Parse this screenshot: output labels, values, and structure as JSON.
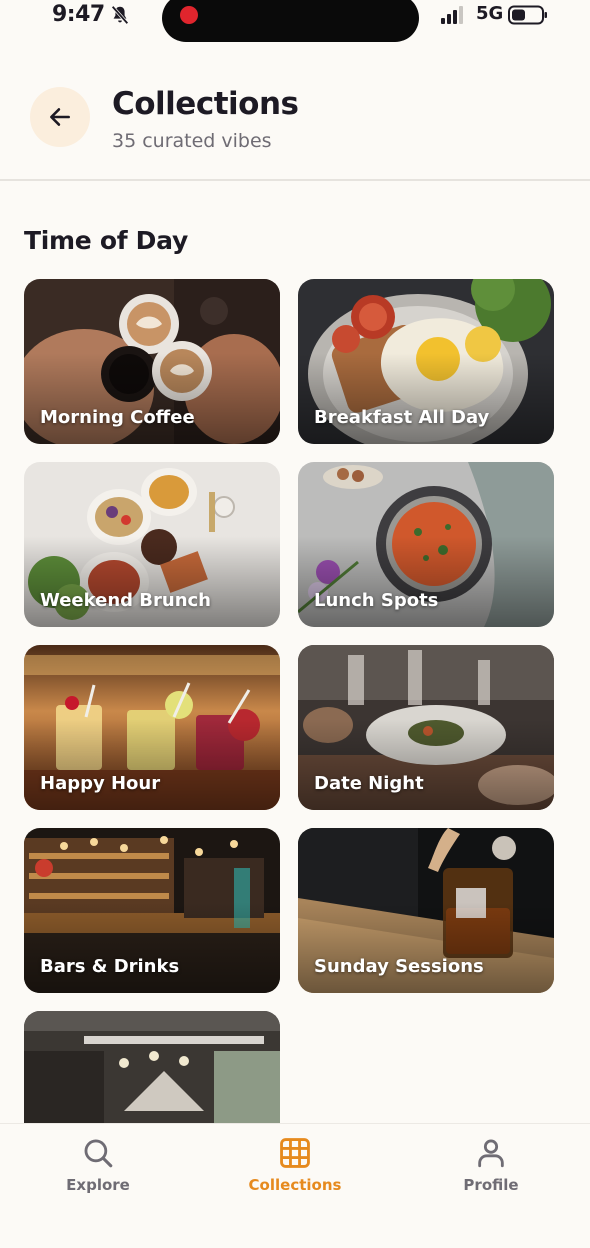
{
  "status_bar": {
    "time": "9:47",
    "network": "5G"
  },
  "header": {
    "title": "Collections",
    "subtitle": "35 curated vibes"
  },
  "section": {
    "title": "Time of Day"
  },
  "cards": [
    {
      "label": "Morning Coffee"
    },
    {
      "label": "Breakfast All Day"
    },
    {
      "label": "Weekend Brunch"
    },
    {
      "label": "Lunch Spots"
    },
    {
      "label": "Happy Hour"
    },
    {
      "label": "Date Night"
    },
    {
      "label": "Bars & Drinks"
    },
    {
      "label": "Sunday Sessions"
    },
    {
      "label": ""
    }
  ],
  "nav": {
    "explore": "Explore",
    "collections": "Collections",
    "profile": "Profile",
    "active": "collections",
    "accent_color": "#e68a1e"
  }
}
